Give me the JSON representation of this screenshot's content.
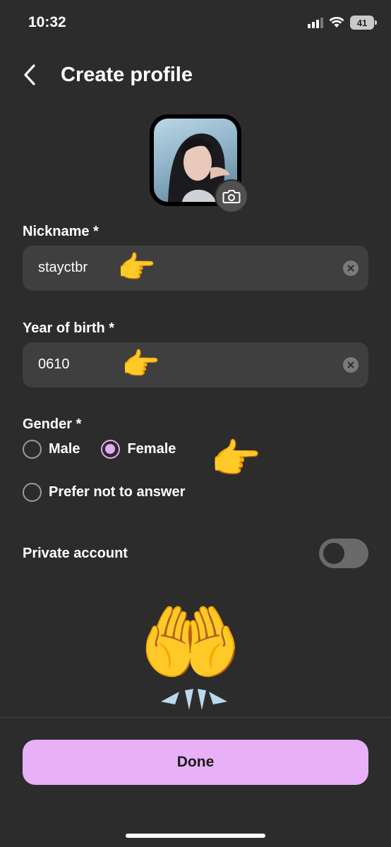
{
  "status_bar": {
    "time": "10:32",
    "battery": "41",
    "icons": [
      "signal-icon",
      "wifi-icon",
      "battery-icon"
    ]
  },
  "header": {
    "title": "Create profile",
    "back_icon": "chevron-left-icon"
  },
  "avatar": {
    "camera_icon": "camera-icon"
  },
  "nickname": {
    "label": "Nickname *",
    "value": "stayctbr",
    "clear_icon": "clear-icon"
  },
  "birth_year": {
    "label": "Year of birth *",
    "value": "0610",
    "clear_icon": "clear-icon"
  },
  "gender": {
    "label": "Gender *",
    "options": [
      {
        "label": "Male",
        "checked": false
      },
      {
        "label": "Female",
        "checked": true
      },
      {
        "label": "Prefer not to answer",
        "checked": false
      }
    ]
  },
  "private_account": {
    "label": "Private account",
    "enabled": false
  },
  "emojis": {
    "pointing_right": "👉",
    "palms_up": "🤲"
  },
  "done_button": {
    "label": "Done"
  },
  "colors": {
    "background": "#2c2c2c",
    "input_bg": "#3f3f3f",
    "accent": "#e8b0f6"
  }
}
